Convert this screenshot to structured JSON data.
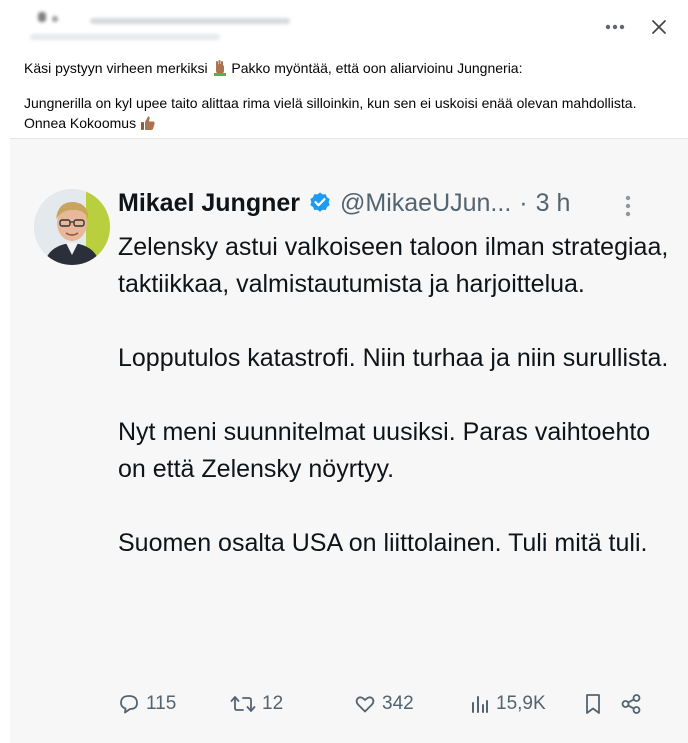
{
  "post": {
    "author_obscured": true,
    "header_actions": [
      "more-icon",
      "close-icon"
    ],
    "line1": "Käsi pystyyn virheen merkiksi",
    "line1_emoji": "raised-hand-icon",
    "line1_rest": "Pakko myöntää, että oon aliarvioinu Jungneria:",
    "line2": "Jungnerilla on kyl upee taito alittaa rima vielä silloinkin, kun sen ei uskoisi enää olevan mahdollista. Onnea Kokoomus",
    "line2_emoji": "thumbs-up-icon"
  },
  "tweet": {
    "name": "Mikael Jungner",
    "handle": "@MikaeUJun...",
    "separator": "·",
    "time": "3 h",
    "verified_color": "#1d9bf0",
    "paragraphs": [
      "Zelensky astui valkoiseen taloon ilman strategiaa, taktiikkaa, valmistautumista ja harjoittelua.",
      "Lopputulos katastrofi. Niin turhaa ja niin surullista.",
      "Nyt meni suunnitelmat uusiksi. Paras vaihtoehto on että Zelensky nöyrtyy.",
      "Suomen osalta USA on liittolainen. Tuli mitä tuli."
    ],
    "actions": {
      "replies": "115",
      "retweets": "12",
      "likes": "342",
      "views": "15,9K"
    }
  },
  "colors": {
    "text": "#050505",
    "tweet_text": "#0f1419",
    "muted": "#536471",
    "card_bg": "#f7f7f7"
  }
}
